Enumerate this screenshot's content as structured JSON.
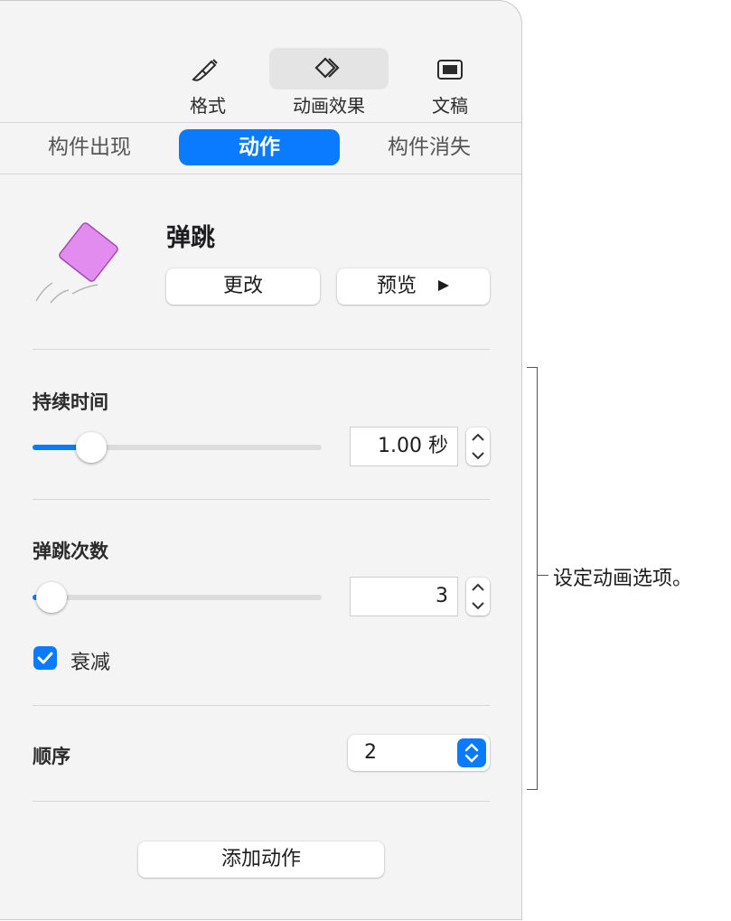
{
  "toolbar": {
    "items": [
      {
        "label": "格式",
        "icon": "paintbrush-icon"
      },
      {
        "label": "动画效果",
        "icon": "animate-diamond-icon",
        "selected": true
      },
      {
        "label": "文稿",
        "icon": "document-icon"
      }
    ]
  },
  "tabs": [
    {
      "label": "构件出现",
      "active": false
    },
    {
      "label": "动作",
      "active": true
    },
    {
      "label": "构件消失",
      "active": false
    }
  ],
  "effect": {
    "name": "弹跳",
    "change_label": "更改",
    "preview_label": "预览",
    "preview_icon": "play-icon",
    "thumbnail_color": "#e38cf0"
  },
  "duration": {
    "label": "持续时间",
    "value": "1.00 秒",
    "slider_fraction": 0.2
  },
  "bounces": {
    "label": "弹跳次数",
    "value": "3",
    "slider_fraction": 0.06
  },
  "decay": {
    "label": "衰减",
    "checked": true
  },
  "order": {
    "label": "顺序",
    "value": "2"
  },
  "add_action_label": "添加动作",
  "callout_text": "设定动画选项。",
  "colors": {
    "accent": "#0a7bff",
    "panel_bg": "#f4f4f4"
  }
}
